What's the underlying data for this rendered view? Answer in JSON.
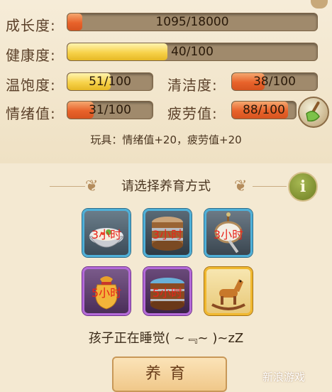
{
  "stats": {
    "growth": {
      "label": "成长度:",
      "text": "1095/18000",
      "fraction": 0.0608
    },
    "health": {
      "label": "健康度:",
      "text": "40/100",
      "fraction": 0.4
    },
    "satiety": {
      "label": "温饱度:",
      "text": "51/100",
      "fraction": 0.51
    },
    "clean": {
      "label": "清洁度:",
      "text": "38/100",
      "fraction": 0.38
    },
    "mood": {
      "label": "情绪值:",
      "text": "31/100",
      "fraction": 0.31
    },
    "fatigue": {
      "label": "疲劳值:",
      "text": "88/100",
      "fraction": 0.88
    }
  },
  "toy_text": "玩具：情绪值+20，疲劳值+20",
  "section_title": "请选择养育方式",
  "info_label": "i",
  "options": [
    {
      "icon": "porridge-bowl-icon",
      "time": "3小时",
      "rarity": "blue"
    },
    {
      "icon": "wooden-barrel-icon",
      "time": "3小时",
      "rarity": "blue"
    },
    {
      "icon": "rattle-drum-icon",
      "time": "3小时",
      "rarity": "blue"
    },
    {
      "icon": "gold-sack-icon",
      "time": "5小时",
      "rarity": "purple"
    },
    {
      "icon": "bath-tub-icon",
      "time": "5小时",
      "rarity": "purple"
    },
    {
      "icon": "rocking-horse-icon",
      "time": "",
      "rarity": "gold"
    }
  ],
  "status_text": "孩子正在睡觉( ~﹃~ )~zZ",
  "raise_button": "养育",
  "watermark": "新浪游戏",
  "colors": {
    "fill_orange": "#e8622a",
    "fill_yellow": "#f7d24a",
    "time_red": "#e8231a",
    "rarity_blue": "#4fb0d8",
    "rarity_purple": "#b46ad8",
    "rarity_gold": "#f0b830"
  }
}
